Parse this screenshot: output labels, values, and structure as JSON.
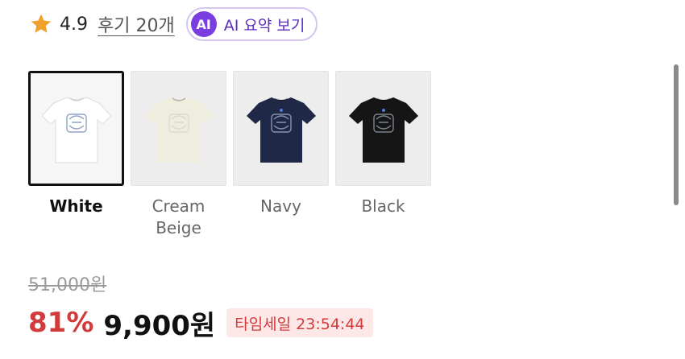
{
  "rating": {
    "score": "4.9",
    "reviews_label": "후기 20개",
    "star_color": "#f0a02c"
  },
  "ai_summary": {
    "badge": "AI",
    "label": "AI 요약 보기",
    "accent": "#7a3ee0"
  },
  "colors": [
    {
      "label": "White",
      "shirt_color": "#ffffff",
      "print_color": "#8fa2c4",
      "selected": true
    },
    {
      "label": "Cream\nBeige",
      "shirt_color": "#efeede",
      "print_color": "#dcdac8",
      "selected": false
    },
    {
      "label": "Navy",
      "shirt_color": "#1f2847",
      "print_color": "#8a93ad",
      "selected": false
    },
    {
      "label": "Black",
      "shirt_color": "#151515",
      "print_color": "#7d8490",
      "selected": false
    }
  ],
  "pricing": {
    "original_price": "51,000원",
    "discount": "81%",
    "sale_price": "9,900원",
    "timesale_label": "타임세일 23:54:44",
    "sale_color": "#d23b3b"
  }
}
